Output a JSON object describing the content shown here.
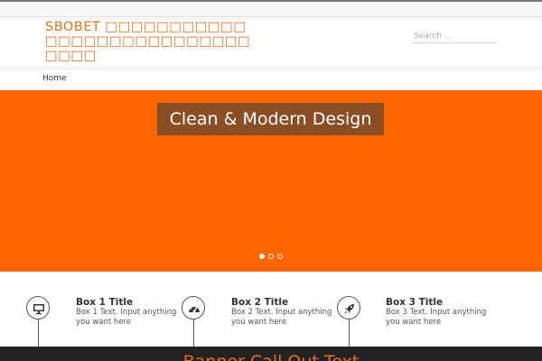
{
  "site": {
    "title": "SBOBET □□□□□□□□□□□□□□□□□□□□□□□□□□□□□□□",
    "search_placeholder": "Search ..."
  },
  "nav": {
    "items": [
      {
        "label": "Home"
      }
    ]
  },
  "slider": {
    "caption": "Clean & Modern Design",
    "background_color": "#ff6600",
    "dots": 3,
    "active_dot": 1
  },
  "features": [
    {
      "icon": "monitor-icon",
      "title": "Box 1 Title",
      "text": "Box 1 Text. Input anything you want here"
    },
    {
      "icon": "speedometer-icon",
      "title": "Box 2 Title",
      "text": "Box 2 Text. Input anything you want here"
    },
    {
      "icon": "rocket-icon",
      "title": "Box 3 Title",
      "text": "Box 3 Text. Input anything you want here"
    }
  ],
  "callout": {
    "text": "Banner Call Out Text"
  },
  "colors": {
    "accent": "#ea6f1a",
    "dark": "#222222"
  }
}
